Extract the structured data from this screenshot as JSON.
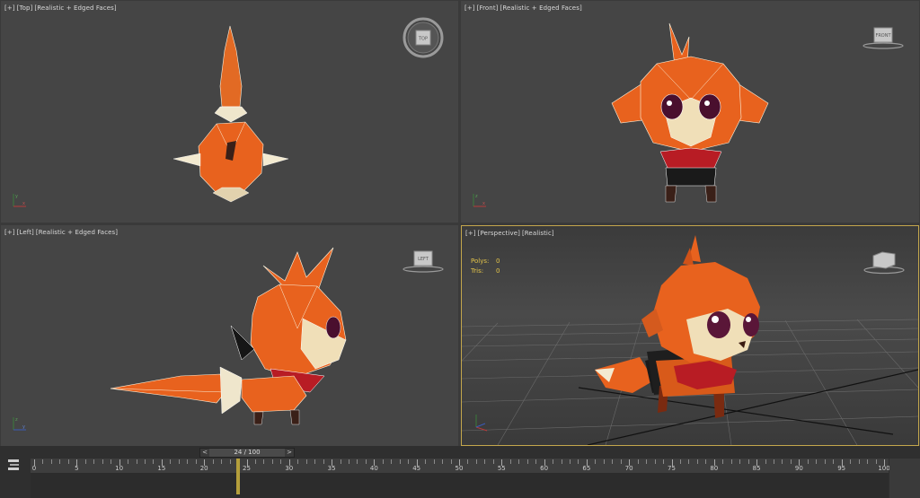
{
  "viewports": {
    "top": {
      "plus": "[+]",
      "view": "[Top]",
      "mode": "[Realistic + Edged Faces]"
    },
    "front": {
      "plus": "[+]",
      "view": "[Front]",
      "mode": "[Realistic + Edged Faces]"
    },
    "left": {
      "plus": "[+]",
      "view": "[Left]",
      "mode": "[Realistic + Edged Faces]"
    },
    "persp": {
      "plus": "[+]",
      "view": "[Perspective]",
      "mode": "[Realistic]"
    }
  },
  "stats": {
    "polys_label": "Polys:",
    "polys_value": "0",
    "tris_label": "Tris:",
    "tris_value": "0"
  },
  "timeline": {
    "prev_label": "<",
    "next_label": ">",
    "current_frame": 24,
    "slider_text": "24 / 100",
    "start": 0,
    "end": 100,
    "labels": [
      "0",
      "5",
      "10",
      "15",
      "20",
      "25",
      "30",
      "35",
      "40",
      "45",
      "50",
      "55",
      "60",
      "65",
      "70",
      "75",
      "80",
      "85",
      "90",
      "95",
      "100"
    ]
  },
  "colors": {
    "active_border": "#c4a74c",
    "stats_text": "#e5c54a",
    "model_orange": "#e8621e",
    "playhead": "#b59f3b"
  },
  "icons": [
    "viewcube-icon",
    "axis-tripod-icon",
    "track-view-icon"
  ]
}
